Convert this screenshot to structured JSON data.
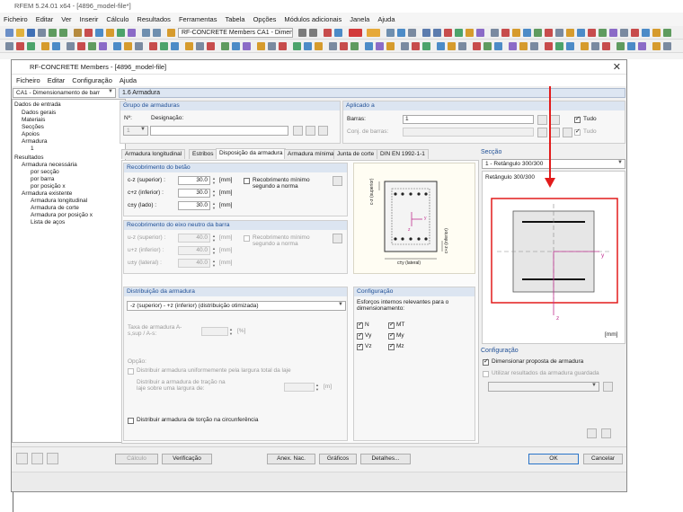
{
  "app": {
    "title": "RFEM 5.24.01 x64 - [4896_model-file*]",
    "menu": [
      "Ficheiro",
      "Editar",
      "Ver",
      "Inserir",
      "Cálculo",
      "Resultados",
      "Ferramentas",
      "Tabela",
      "Opções",
      "Módulos adicionais",
      "Janela",
      "Ajuda"
    ],
    "toolbar_combo": "RF-CONCRETE Members CA1 - Dimensi"
  },
  "dialog": {
    "title": "RF-CONCRETE Members - [4896_model-file]",
    "close": "✕",
    "menu": [
      "Ficheiro",
      "Editar",
      "Configuração",
      "Ajuda"
    ],
    "case_combo": "CA1 - Dimensionamento de barr",
    "pane_title": "1.6 Armadura",
    "nav": {
      "input_header": "Dados de entrada",
      "input_items": [
        "Dados gerais",
        "Materiais",
        "Secções",
        "Apoios",
        "Armadura",
        "1"
      ],
      "results_header": "Resultados",
      "results_items": [
        "Armadura necessária",
        "por secção",
        "por barra",
        "por posição x",
        "Armadura existente",
        "Armadura longitudinal",
        "Armadura de corte",
        "Armadura por posição x",
        "Lista de aços"
      ]
    },
    "group": {
      "header": "Grupo de armaduras",
      "no_label": "Nº:",
      "designation_label": "Designação:",
      "no_value": "1"
    },
    "applied": {
      "header": "Aplicado a",
      "bars_label": "Barras:",
      "bars_value": "1",
      "sets_label": "Conj. de barras:",
      "all_label": "Tudo"
    },
    "tabs": [
      "Armadura longitudinal",
      "Estribos",
      "Disposição da armadura",
      "Armadura mínima",
      "Junta de corte",
      "DIN EN 1992-1-1"
    ],
    "cover": {
      "header": "Recobrimento do betão",
      "rows": [
        {
          "label": "c-z (superior) :",
          "value": "30.0"
        },
        {
          "label": "c+z (inferior) :",
          "value": "30.0"
        },
        {
          "label": "c±y (lado) :",
          "value": "30.0"
        }
      ],
      "unit": "[mm]",
      "min_label": "Recobrimento mínimo segundo a norma"
    },
    "axis_cover": {
      "header": "Recobrimento do eixo neutro da barra",
      "rows": [
        {
          "label": "u-z (superior) :",
          "value": "40.0"
        },
        {
          "label": "u+z (inferior) :",
          "value": "40.0"
        },
        {
          "label": "u±y (lateral) :",
          "value": "40.0"
        }
      ],
      "unit": "[mm]",
      "min_label": "Recobrimento mínimo segundo a norma"
    },
    "sketch": {
      "c_top": "c-z (superior)",
      "c_bottom": "c+z (inferior)",
      "c_side": "c±y (lateral)",
      "axis_y": "y",
      "axis_z": "z"
    },
    "distribution": {
      "header": "Distribuição da armadura",
      "combo": "-z (superior) - +z (inferior) (distribuição otimizada)",
      "ratio_label": "Taxa de armadura A-s,sup / A-s:",
      "ratio_unit": "[%]",
      "option_label": "Opção:",
      "uniform_label": "Distribuir armadura uniformemente pela largura total da laje",
      "traction_label": "Distribuir a armadura de tração na laje sobre uma largura de:",
      "traction_unit": "[m]",
      "torsion_label": "Distribuir armadura de torção na circunferência"
    },
    "config": {
      "header": "Configuração",
      "forces_label": "Esforços internos relevantes para o dimensionamento:",
      "checks": [
        "N",
        "MT",
        "Vy",
        "My",
        "Vz",
        "Mz"
      ]
    },
    "section": {
      "header": "Secção",
      "combo": "1 - Retângulo 300/300",
      "name": "Retângulo 300/300",
      "unit": "[mm]",
      "axis_y": "y",
      "axis_z": "z"
    },
    "config2": {
      "header": "Configuração",
      "check1": "Dimensionar proposta de armadura",
      "check2": "Utilizar resultados da armadura guardada"
    },
    "buttons": {
      "calc": "Cálculo",
      "verify": "Verificação",
      "annex": "Anex. Nac.",
      "graphs": "Gráficos",
      "details": "Detalhes...",
      "ok": "OK",
      "cancel": "Cancelar"
    }
  },
  "colors": {
    "accent": "#1f4f96",
    "annotation_red": "#e21b1b",
    "header_blue": "#dce5f1"
  }
}
